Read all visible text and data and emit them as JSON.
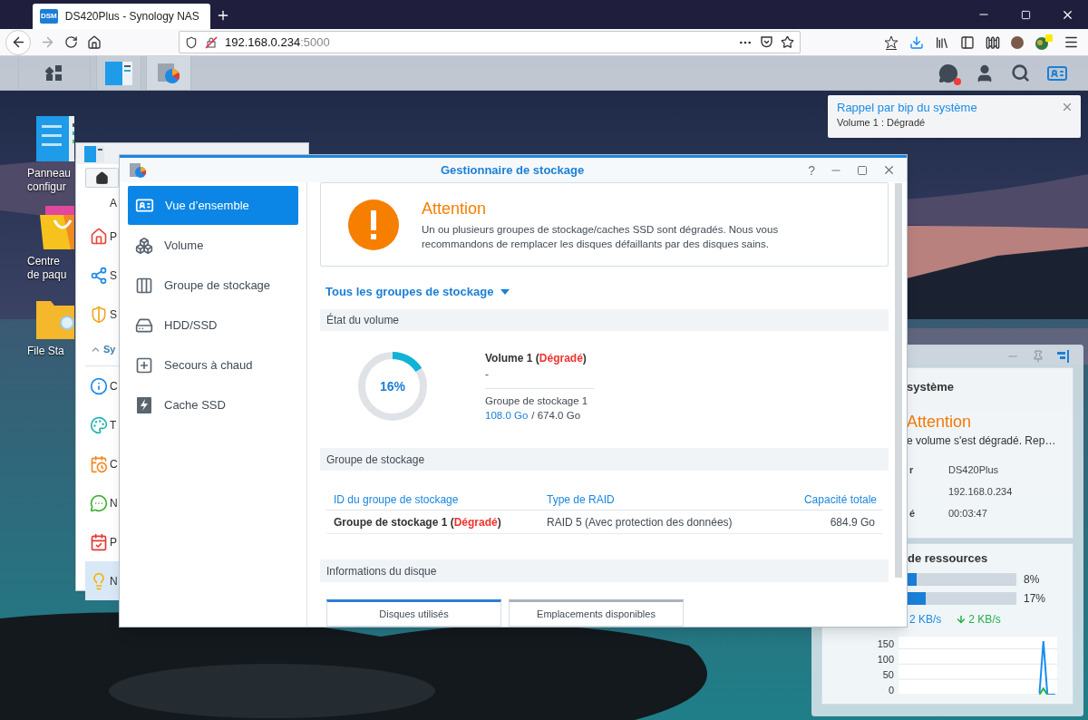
{
  "browser": {
    "tab": {
      "favicon_text": "DSM",
      "title": "DS420Plus - Synology NAS",
      "selected": true
    },
    "address": {
      "host": "192.168.0.234",
      "port": ":5000"
    }
  },
  "desktop_icons": [
    {
      "kind": "control_panel",
      "label_lines": [
        "Panneau",
        "configur"
      ]
    },
    {
      "kind": "package_center",
      "label_lines": [
        "Centre",
        "de paqu"
      ]
    },
    {
      "kind": "file_station",
      "label_lines": [
        "File Sta"
      ]
    }
  ],
  "notification": {
    "title": "Rappel par bip du système",
    "message": "Volume 1 : Dégradé"
  },
  "control_panel": {
    "items": [
      {
        "kind": "item",
        "label": "A",
        "selected": false
      },
      {
        "kind": "item",
        "label": "P",
        "selected": false
      },
      {
        "kind": "item",
        "label": "S",
        "selected": false
      },
      {
        "kind": "item",
        "label": "S",
        "selected": false
      },
      {
        "kind": "section",
        "label": "Sy",
        "expanded": true
      },
      {
        "kind": "item",
        "label": "C",
        "selected": false
      },
      {
        "kind": "item",
        "label": "T",
        "selected": false
      },
      {
        "kind": "item",
        "label": "C",
        "selected": false
      },
      {
        "kind": "item",
        "label": "N",
        "selected": false
      },
      {
        "kind": "item",
        "label": "P",
        "selected": false
      },
      {
        "kind": "item",
        "label": "N",
        "selected": true
      }
    ]
  },
  "storage_manager": {
    "title": "Gestionnaire de stockage",
    "help": "?",
    "sidebar": [
      {
        "label": "Vue d’ensemble",
        "selected": true
      },
      {
        "label": "Volume",
        "selected": false
      },
      {
        "label": "Groupe de stockage",
        "selected": false
      },
      {
        "label": "HDD/SSD",
        "selected": false
      },
      {
        "label": "Secours à chaud",
        "selected": false
      },
      {
        "label": "Cache SSD",
        "selected": false
      }
    ],
    "alert": {
      "title": "Attention",
      "message": "Un ou plusieurs groupes de stockage/caches SSD sont dégradés. Nous vous recommandons de remplacer les disques défaillants par des disques sains."
    },
    "filter": "Tous les groupes de stockage",
    "volume_section": {
      "heading": "État du volume",
      "usage_text": "16%",
      "level": 0.16,
      "name": "Volume 1 (",
      "status": "Dégradé",
      "name_end": ")",
      "description": "-",
      "pool": "Groupe de stockage 1",
      "used": "108.0 Go",
      "total": "/ 674.0 Go"
    },
    "pool_section": {
      "heading": "Groupe de stockage",
      "columns": [
        "ID du groupe de stockage",
        "Type de RAID",
        "Capacité totale"
      ],
      "rows": [
        {
          "name": "Groupe de stockage 1 (",
          "status": "Dégradé",
          "name_end": ")",
          "raid": "RAID 5 (Avec protection des données)",
          "capacity": "684.9 Go"
        }
      ]
    },
    "disk_section": {
      "heading": "Informations du disque",
      "tabs": [
        {
          "label": "Disques utilisés",
          "selected": true
        },
        {
          "label": "Emplacements disponibles",
          "selected": false
        }
      ]
    }
  },
  "widget": {
    "health": {
      "title": "système",
      "status": "Attention",
      "message": "e volume s'est dégradé. Rep…",
      "rows": [
        {
          "label": "r",
          "value": "DS420Plus"
        },
        {
          "value": "192.168.0.234"
        },
        {
          "label": "é",
          "value": "00:03:47"
        }
      ]
    },
    "resources": {
      "title": "de ressources",
      "meters": [
        {
          "level": 0.08,
          "reading": "8%"
        },
        {
          "level": 0.17,
          "reading": "17%"
        }
      ],
      "upload": "2 KB/s",
      "download": "2 KB/s",
      "chart_data": {
        "type": "line",
        "grid": true,
        "ylim": [
          0,
          190
        ],
        "yticks": [
          {
            "value": 0,
            "label": "0"
          },
          {
            "value": 50,
            "label": "50"
          },
          {
            "value": 100,
            "label": "100"
          },
          {
            "value": 150,
            "label": "150"
          }
        ],
        "series": [
          {
            "color": "#1a8cf0",
            "values": [
              null,
              null,
              null,
              null,
              null,
              null,
              null,
              null,
              null,
              null,
              null,
              null,
              null,
              null,
              null,
              null,
              null,
              null,
              null,
              null,
              null,
              null,
              null,
              null,
              null,
              null,
              null,
              null,
              null,
              null,
              null,
              null,
              null,
              null,
              null,
              5,
              175,
              0,
              0,
              0
            ]
          },
          {
            "color": "#22b14c",
            "values": [
              null,
              null,
              null,
              null,
              null,
              null,
              null,
              null,
              null,
              null,
              null,
              null,
              null,
              null,
              null,
              null,
              null,
              null,
              null,
              null,
              null,
              null,
              null,
              null,
              null,
              null,
              null,
              null,
              null,
              null,
              null,
              null,
              null,
              null,
              null,
              0,
              20,
              0,
              null,
              null
            ]
          }
        ]
      }
    }
  }
}
